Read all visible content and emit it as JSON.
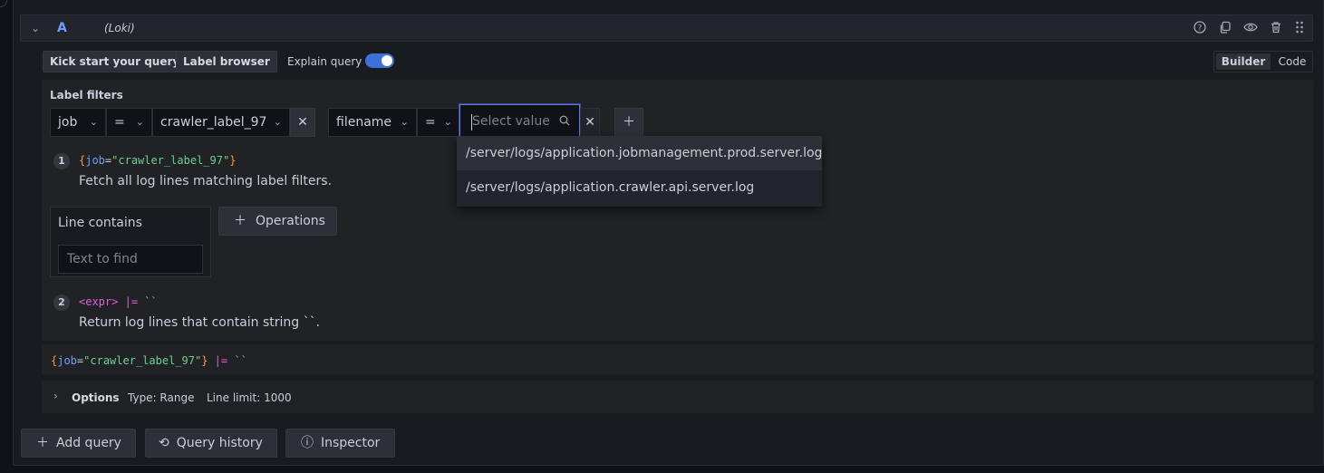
{
  "query": {
    "letter": "A",
    "datasource": "(Loki)",
    "header_icons": [
      "help-icon",
      "copy-icon",
      "eye-icon",
      "trash-icon",
      "drag-handle-icon"
    ]
  },
  "toolbar": {
    "kick_start": "Kick start your query",
    "label_browser": "Label browser",
    "explain_query": "Explain query",
    "explain_enabled": true,
    "mode_builder": "Builder",
    "mode_code": "Code"
  },
  "label_filters": {
    "title": "Label filters",
    "filter1": {
      "label": "job",
      "operator": "=",
      "value": "crawler_label_97"
    },
    "filter2": {
      "label": "filename",
      "operator": "=",
      "value_placeholder": "Select value"
    }
  },
  "dropdown": {
    "options": [
      "/server/logs/application.jobmanagement.prod.server.log",
      "/server/logs/application.crawler.api.server.log"
    ]
  },
  "steps": [
    {
      "number": "1",
      "code_open": "{",
      "code_key": "job",
      "code_eq": "=",
      "code_val": "\"crawler_label_97\"",
      "code_close": "}",
      "description": "Fetch all log lines matching label filters."
    },
    {
      "number": "2",
      "code_expr": "<expr>",
      "code_op": "|=",
      "code_str": "``",
      "description": "Return log lines that contain string ``."
    }
  ],
  "line_contains": {
    "title": "Line contains",
    "placeholder": "Text to find"
  },
  "operations_button": "Operations",
  "raw_query": {
    "open": "{",
    "key": "job",
    "eq": "=",
    "val": "\"crawler_label_97\"",
    "close": "}",
    "op": "|=",
    "str": "``"
  },
  "options": {
    "label": "Options",
    "type": "Type: Range",
    "line_limit": "Line limit: 1000"
  },
  "footer": {
    "add_query": "Add query",
    "query_history": "Query history",
    "inspector": "Inspector"
  }
}
